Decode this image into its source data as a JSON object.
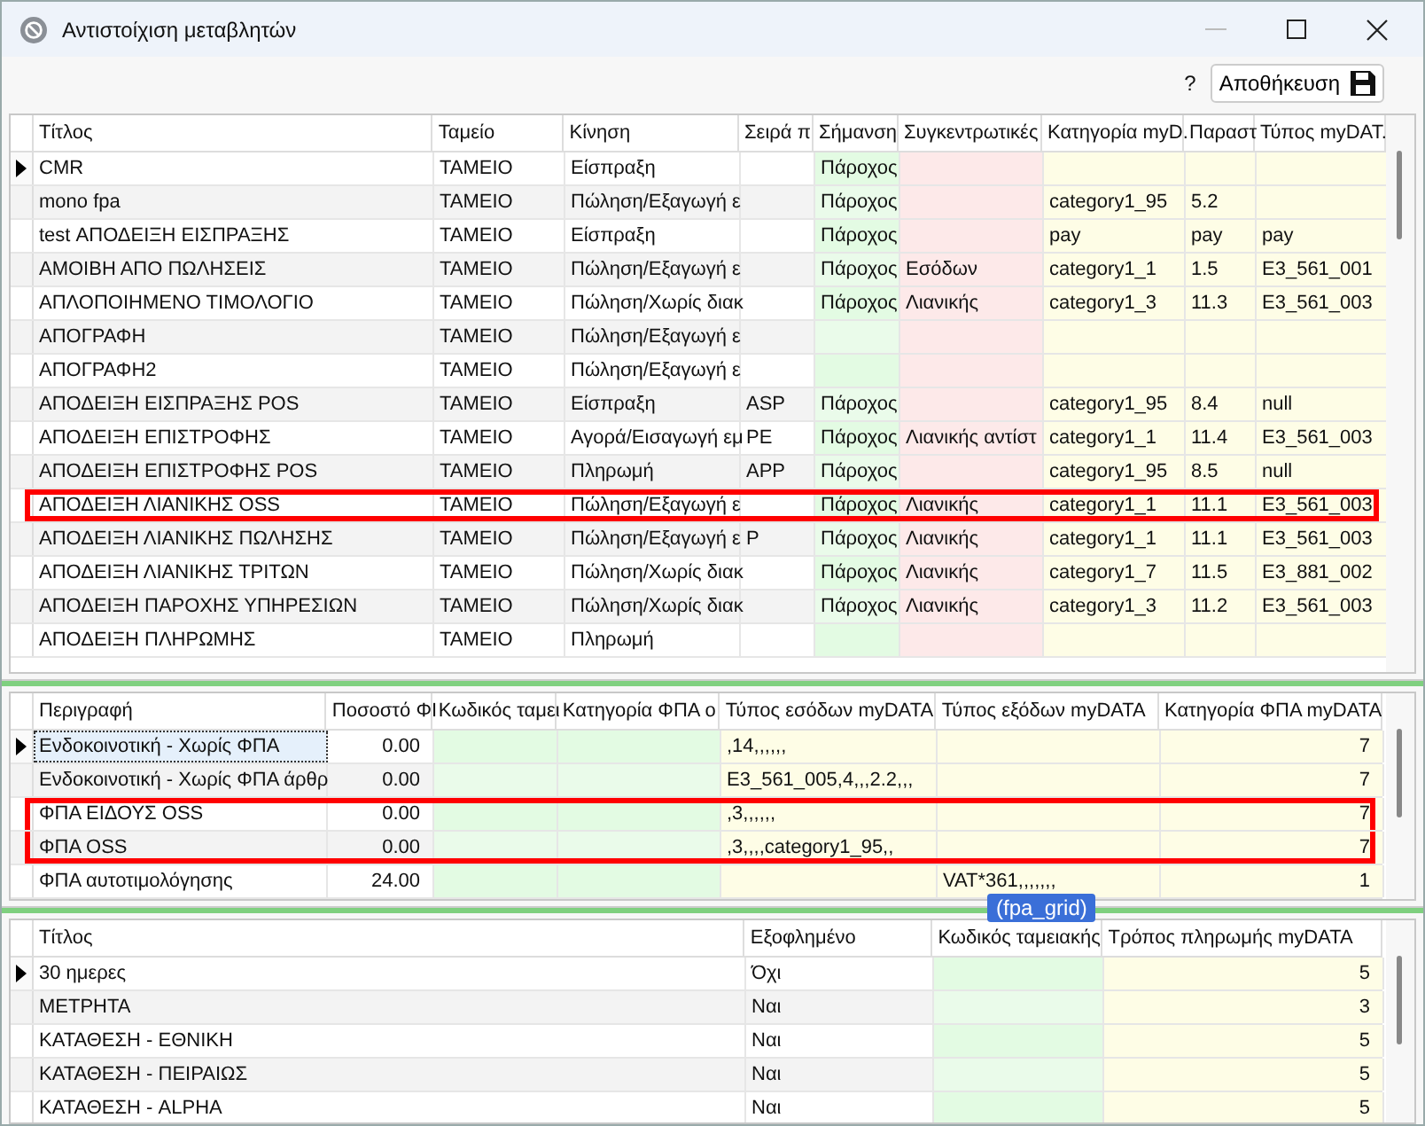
{
  "window": {
    "title": "Αντιστοίχιση μεταβλητών"
  },
  "toolbar": {
    "help": "?",
    "save_button": "Αποθήκευση"
  },
  "documents_grid": {
    "columns": [
      {
        "label": "Τίτλος",
        "kind": "text"
      },
      {
        "label": "Ταμείο",
        "kind": "text"
      },
      {
        "label": "Κίνηση",
        "kind": "text"
      },
      {
        "label": "Σειρά π",
        "kind": "text"
      },
      {
        "label": "Σήμανση",
        "kind": "code"
      },
      {
        "label": "Συγκεντρωτικές",
        "kind": "summary"
      },
      {
        "label": "Κατηγορία myD.",
        "kind": "mydata"
      },
      {
        "label": "Παραστ",
        "kind": "mydata"
      },
      {
        "label": "Τύπος myDAT.",
        "kind": "mydata"
      }
    ],
    "rows": [
      {
        "current": true,
        "highlighted": false,
        "cells": [
          "CMR",
          "ΤΑΜΕΙΟ",
          "Είσπραξη",
          "",
          "Πάροχος",
          "",
          "",
          "",
          ""
        ]
      },
      {
        "current": false,
        "highlighted": false,
        "cells": [
          "mono fpa",
          "ΤΑΜΕΙΟ",
          "Πώληση/Εξαγωγή ε",
          "",
          "Πάροχος",
          "",
          "category1_95",
          "5.2",
          ""
        ]
      },
      {
        "current": false,
        "highlighted": false,
        "cells": [
          "test ΑΠΟΔΕΙΞΗ ΕΙΣΠΡΑΞΗΣ",
          "ΤΑΜΕΙΟ",
          "Είσπραξη",
          "",
          "Πάροχος",
          "",
          "pay",
          "pay",
          "pay"
        ]
      },
      {
        "current": false,
        "highlighted": false,
        "cells": [
          "ΑΜΟΙΒΗ ΑΠΟ ΠΩΛΗΣΕΙΣ",
          "ΤΑΜΕΙΟ",
          "Πώληση/Εξαγωγή ε",
          "",
          "Πάροχος",
          "Εσόδων",
          "category1_1",
          "1.5",
          "E3_561_001"
        ]
      },
      {
        "current": false,
        "highlighted": false,
        "cells": [
          "ΑΠΛΟΠΟΙΗΜΕΝΟ ΤΙΜΟΛΟΓΙΟ",
          "ΤΑΜΕΙΟ",
          "Πώληση/Χωρίς διακ",
          "",
          "Πάροχος",
          "Λιανικής",
          "category1_3",
          "11.3",
          "E3_561_003"
        ]
      },
      {
        "current": false,
        "highlighted": false,
        "cells": [
          "ΑΠΟΓΡΑΦΗ",
          "ΤΑΜΕΙΟ",
          "Πώληση/Εξαγωγή ε",
          "",
          "",
          "",
          "",
          "",
          ""
        ]
      },
      {
        "current": false,
        "highlighted": false,
        "cells": [
          "ΑΠΟΓΡΑΦΗ2",
          "ΤΑΜΕΙΟ",
          "Πώληση/Εξαγωγή ε",
          "",
          "",
          "",
          "",
          "",
          ""
        ]
      },
      {
        "current": false,
        "highlighted": false,
        "cells": [
          "ΑΠΟΔΕΙΞΗ ΕΙΣΠΡΑΞΗΣ POS",
          "ΤΑΜΕΙΟ",
          "Είσπραξη",
          "ASP",
          "Πάροχος",
          "",
          "category1_95",
          "8.4",
          "null"
        ]
      },
      {
        "current": false,
        "highlighted": false,
        "cells": [
          "ΑΠΟΔΕΙΞΗ ΕΠΙΣΤΡΟΦΗΣ",
          "ΤΑΜΕΙΟ",
          "Αγορά/Εισαγωγή εμ",
          "PE",
          "Πάροχος",
          "Λιανικής αντίστ",
          "category1_1",
          "11.4",
          "E3_561_003"
        ]
      },
      {
        "current": false,
        "highlighted": false,
        "cells": [
          "ΑΠΟΔΕΙΞΗ ΕΠΙΣΤΡΟΦΗΣ POS",
          "ΤΑΜΕΙΟ",
          "Πληρωμή",
          "APP",
          "Πάροχος",
          "",
          "category1_95",
          "8.5",
          "null"
        ]
      },
      {
        "current": false,
        "highlighted": true,
        "cells": [
          "ΑΠΟΔΕΙΞΗ ΛΙΑΝΙΚΗΣ OSS",
          "ΤΑΜΕΙΟ",
          "Πώληση/Εξαγωγή ε",
          "",
          "Πάροχος",
          "Λιανικής",
          "category1_1",
          "11.1",
          "E3_561_003"
        ]
      },
      {
        "current": false,
        "highlighted": false,
        "cells": [
          "ΑΠΟΔΕΙΞΗ ΛΙΑΝΙΚΗΣ ΠΩΛΗΣΗΣ",
          "ΤΑΜΕΙΟ",
          "Πώληση/Εξαγωγή ε",
          "P",
          "Πάροχος",
          "Λιανικής",
          "category1_1",
          "11.1",
          "E3_561_003"
        ]
      },
      {
        "current": false,
        "highlighted": false,
        "cells": [
          "ΑΠΟΔΕΙΞΗ ΛΙΑΝΙΚΗΣ ΤΡΙΤΩΝ",
          "ΤΑΜΕΙΟ",
          "Πώληση/Χωρίς διακ",
          "",
          "Πάροχος",
          "Λιανικής",
          "category1_7",
          "11.5",
          "E3_881_002"
        ]
      },
      {
        "current": false,
        "highlighted": false,
        "cells": [
          "ΑΠΟΔΕΙΞΗ ΠΑΡΟΧΗΣ ΥΠΗΡΕΣΙΩΝ",
          "ΤΑΜΕΙΟ",
          "Πώληση/Χωρίς διακ",
          "",
          "Πάροχος",
          "Λιανικής",
          "category1_3",
          "11.2",
          "E3_561_003"
        ]
      },
      {
        "current": false,
        "highlighted": false,
        "cells": [
          "ΑΠΟΔΕΙΞΗ ΠΛΗΡΩΜΗΣ",
          "ΤΑΜΕΙΟ",
          "Πληρωμή",
          "",
          "",
          "",
          "",
          "",
          ""
        ]
      }
    ]
  },
  "fpa_grid": {
    "columns": [
      {
        "label": "Περιγραφή",
        "kind": "text"
      },
      {
        "label": "Ποσοστό ΦΙ",
        "kind": "number"
      },
      {
        "label": "Κωδικός ταμει",
        "kind": "code"
      },
      {
        "label": "Κατηγορία ΦΠΑ ο",
        "kind": "code"
      },
      {
        "label": "Τύπος εσόδων myDATA",
        "kind": "mydata"
      },
      {
        "label": "Τύπος εξόδων myDATA",
        "kind": "mydata"
      },
      {
        "label": "Κατηγορία ΦΠΑ myDATA",
        "kind": "mydata-number"
      }
    ],
    "rows": [
      {
        "current": true,
        "highlighted": false,
        "cells": [
          "Ενδοκοινοτική - Χωρίς ΦΠΑ",
          "0.00",
          "",
          "",
          ",14,,,,,,",
          "",
          "7"
        ]
      },
      {
        "current": false,
        "highlighted": false,
        "cells": [
          "Ενδοκοινοτική - Χωρίς ΦΠΑ άρθρ",
          "0.00",
          "",
          "",
          "E3_561_005,4,,,2.2,,,",
          "",
          "7"
        ]
      },
      {
        "current": false,
        "highlighted": true,
        "cells": [
          "ΦΠΑ ΕΙΔΟΥΣ OSS",
          "0.00",
          "",
          "",
          ",3,,,,,,",
          "",
          "7"
        ]
      },
      {
        "current": false,
        "highlighted": true,
        "cells": [
          "ΦΠΑ OSS",
          "0.00",
          "",
          "",
          ",3,,,,category1_95,,",
          "",
          "7"
        ]
      },
      {
        "current": false,
        "highlighted": false,
        "cells": [
          "ΦΠΑ αυτοτιμολόγησης",
          "24.00",
          "",
          "",
          "",
          "VAT*361,,,,,,,",
          "1"
        ]
      }
    ],
    "tooltip": "(fpa_grid)"
  },
  "payment_grid": {
    "columns": [
      {
        "label": "Τίτλος",
        "kind": "text"
      },
      {
        "label": "Εξοφλημένο",
        "kind": "text"
      },
      {
        "label": "Κωδικός ταμειακής",
        "kind": "code"
      },
      {
        "label": "Τρόπος πληρωμής myDATA",
        "kind": "mydata-number"
      }
    ],
    "rows": [
      {
        "current": true,
        "highlighted": false,
        "cells": [
          "30 ημερες",
          "Όχι",
          "",
          "5"
        ]
      },
      {
        "current": false,
        "highlighted": false,
        "cells": [
          "ΜΕΤΡΗΤΑ",
          "Ναι",
          "",
          "3"
        ]
      },
      {
        "current": false,
        "highlighted": false,
        "cells": [
          "ΚΑΤΑΘΕΣΗ - ΕΘΝΙΚΗ",
          "Ναι",
          "",
          "5"
        ]
      },
      {
        "current": false,
        "highlighted": false,
        "cells": [
          "ΚΑΤΑΘΕΣΗ - ΠΕΙΡΑΙΩΣ",
          "Ναι",
          "",
          "5"
        ]
      },
      {
        "current": false,
        "highlighted": false,
        "cells": [
          "ΚΑΤΑΘΕΣΗ - ALPHA",
          "Ναι",
          "",
          "5"
        ]
      }
    ]
  }
}
